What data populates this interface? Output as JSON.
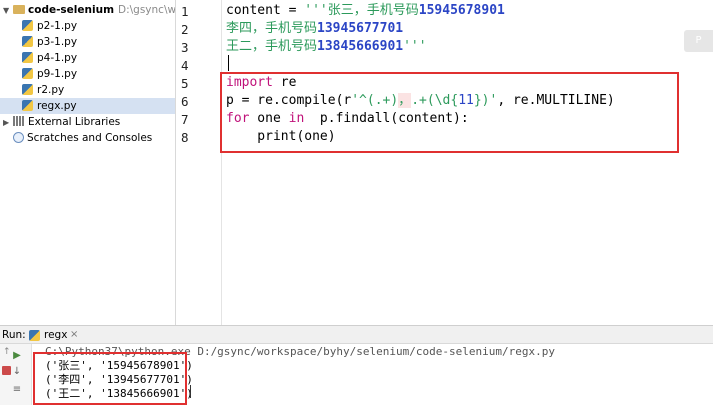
{
  "project": {
    "root_name": "code-selenium",
    "root_path": "D:\\gsync\\workspa",
    "files": [
      "p2-1.py",
      "p3-1.py",
      "p4-1.py",
      "p9-1.py",
      "r2.py",
      "regx.py"
    ],
    "selected_file": "regx.py",
    "external_libraries": "External Libraries",
    "scratches": "Scratches and Consoles"
  },
  "editor": {
    "line_numbers": [
      "1",
      "2",
      "3",
      "4",
      "5",
      "6",
      "7",
      "8"
    ],
    "line1": {
      "code": "content = ",
      "str": "'''张三，手机号码",
      "num": "15945678901"
    },
    "line2": {
      "str": "李四，手机号码",
      "num": "13945677701"
    },
    "line3": {
      "str": "王二，手机号码",
      "num": "13845666901",
      "str_end": "'''"
    },
    "line5": {
      "kw": "import",
      "rest": " re"
    },
    "line6": {
      "a": "p = re.compile(r",
      "s1": "'^(.+)",
      "s2": "，",
      "s3": ".+(\\d{",
      "n": "11",
      "s4": "})'",
      "b": ", re.MULTILINE)"
    },
    "line7": {
      "kw1": "for",
      "a": " one ",
      "kw2": "in",
      "b": "  p.findall(content):"
    },
    "line8": {
      "a": "    print(one)"
    },
    "side_chip": "P"
  },
  "run": {
    "label": "Run:",
    "tab": "regx",
    "command": "C:\\Python37\\python.exe D:/gsync/workspace/byhy/selenium/code-selenium/regx.py",
    "output": [
      "('张三', '15945678901')",
      "('李四', '13945677701')",
      "('王二', '13845666901')"
    ]
  }
}
